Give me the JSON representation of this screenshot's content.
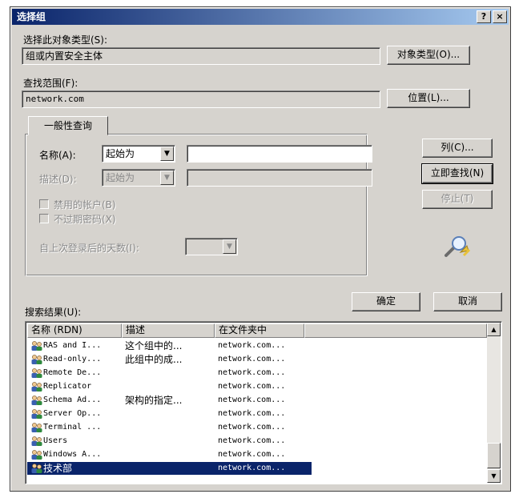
{
  "window": {
    "title": "选择组",
    "help_glyph": "?",
    "close_glyph": "×"
  },
  "object_type": {
    "label": "选择此对象类型(S):",
    "value": "组或内置安全主体",
    "button": "对象类型(O)..."
  },
  "location": {
    "label": "查找范围(F):",
    "value": "network.com",
    "button": "位置(L)..."
  },
  "query": {
    "tab_label": "一般性查询",
    "name_label": "名称(A):",
    "name_op": "起始为",
    "name_value": "",
    "desc_label": "描述(D):",
    "desc_op": "起始为",
    "desc_value": "",
    "disabled_accounts_label": "禁用的帐户(B)",
    "non_expiring_label": "不过期密码(X)",
    "days_since_label": "自上次登录后的天数(I):",
    "days_value": ""
  },
  "side_buttons": {
    "columns": "列(C)...",
    "find_now": "立即查找(N)",
    "stop": "停止(T)"
  },
  "footer": {
    "ok": "确定",
    "cancel": "取消"
  },
  "results": {
    "label": "搜索结果(U):",
    "columns": [
      "名称 (RDN)",
      "描述",
      "在文件夹中"
    ],
    "rows": [
      {
        "name": "RAS and I...",
        "desc": "这个组中的...",
        "folder": "network.com..."
      },
      {
        "name": "Read-only...",
        "desc": "此组中的成...",
        "folder": "network.com..."
      },
      {
        "name": "Remote De...",
        "desc": "",
        "folder": "network.com..."
      },
      {
        "name": "Replicator",
        "desc": "",
        "folder": "network.com..."
      },
      {
        "name": "Schema Ad...",
        "desc": "架构的指定...",
        "folder": "network.com..."
      },
      {
        "name": "Server Op...",
        "desc": "",
        "folder": "network.com..."
      },
      {
        "name": "Terminal ...",
        "desc": "",
        "folder": "network.com..."
      },
      {
        "name": "Users",
        "desc": "",
        "folder": "network.com..."
      },
      {
        "name": "Windows A...",
        "desc": "",
        "folder": "network.com..."
      },
      {
        "name": "技术部",
        "desc": "",
        "folder": "network.com..."
      }
    ],
    "selected_index": 9
  },
  "icons": {
    "group": "group-icon",
    "search_graphic": "search-animation-icon"
  }
}
